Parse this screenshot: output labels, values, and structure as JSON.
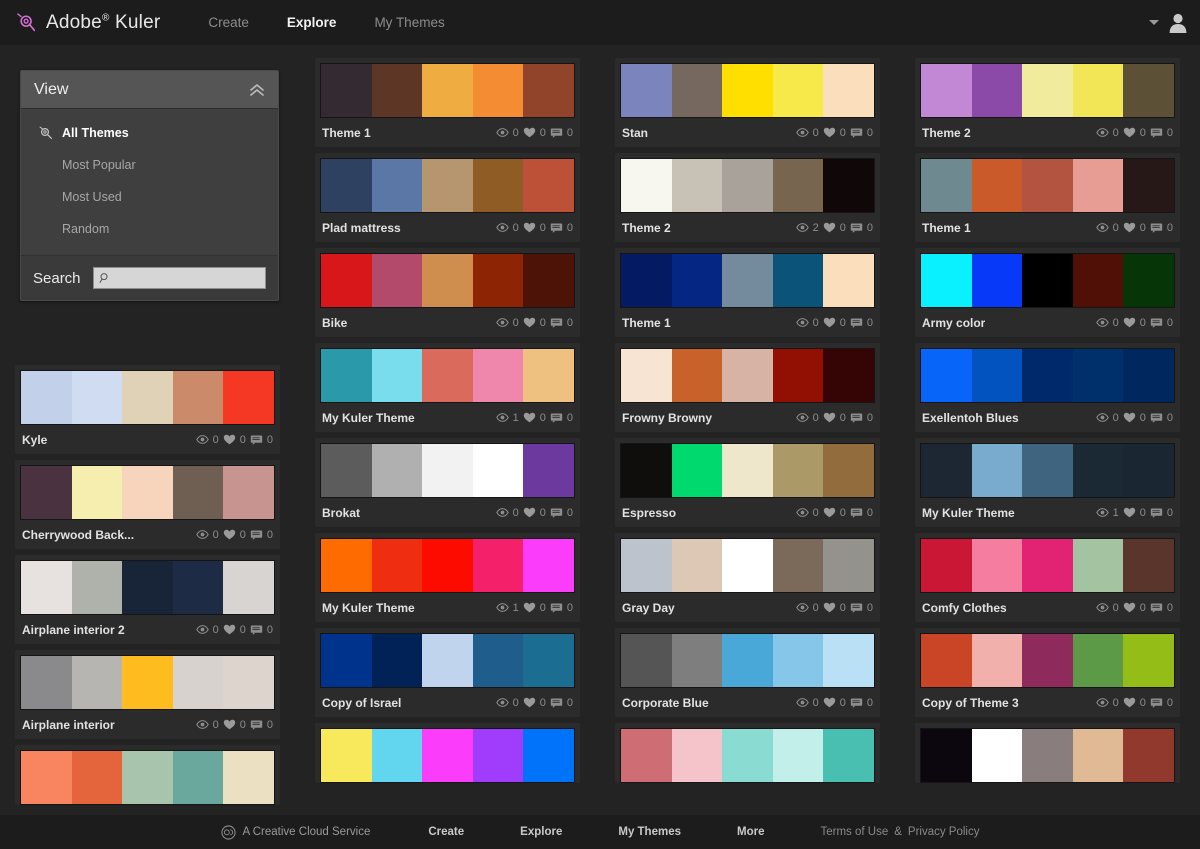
{
  "header": {
    "brand": "Adobe",
    "brand_sup": "®",
    "brand2": "Kuler",
    "logo_icon": "kuler-logo-icon",
    "nav": [
      {
        "label": "Create",
        "active": false
      },
      {
        "label": "Explore",
        "active": true
      },
      {
        "label": "My Themes",
        "active": false
      }
    ],
    "caret_icon": "chevron-down-icon",
    "avatar_icon": "user-avatar-icon"
  },
  "sidebar": {
    "title": "View",
    "collapse_icon": "chevron-double-up-icon",
    "items": [
      {
        "label": "All Themes",
        "active": true,
        "icon": "kuler-mark-icon"
      },
      {
        "label": "Most Popular",
        "active": false,
        "icon": ""
      },
      {
        "label": "Most Used",
        "active": false,
        "icon": ""
      },
      {
        "label": "Random",
        "active": false,
        "icon": ""
      }
    ],
    "search_label": "Search",
    "search_value": "",
    "search_placeholder": "",
    "search_icon": "magnifier-icon"
  },
  "stats_icons": {
    "views": "eye-icon",
    "likes": "heart-icon",
    "comments": "comment-icon"
  },
  "columns": [
    {
      "themes": [
        {
          "name": "Kyle",
          "views": "0",
          "likes": "0",
          "comments": "0",
          "colors": [
            "#c3d0ea",
            "#cfdcf2",
            "#e0d2b7",
            "#cb8a6a",
            "#f53823"
          ]
        },
        {
          "name": "Cherrywood Back...",
          "views": "0",
          "likes": "0",
          "comments": "0",
          "colors": [
            "#4b3240",
            "#f5eeae",
            "#f7d5bc",
            "#6f5e52",
            "#c79490"
          ]
        },
        {
          "name": "Airplane interior 2",
          "views": "0",
          "likes": "0",
          "comments": "0",
          "colors": [
            "#e7e1df",
            "#aeb2ab",
            "#182437",
            "#1e2b45",
            "#d7d4d1"
          ]
        },
        {
          "name": "Airplane interior",
          "views": "0",
          "likes": "0",
          "comments": "0",
          "colors": [
            "#8a8a8c",
            "#b7b5b1",
            "#ffbc1f",
            "#d8d2ce",
            "#ddd5cd"
          ]
        },
        {
          "name": "",
          "views": "",
          "likes": "",
          "comments": "",
          "partial": true,
          "colors": [
            "#f98560",
            "#e4653c",
            "#a9c4ad",
            "#6aa79c",
            "#ece0c2"
          ]
        }
      ]
    },
    {
      "themes": [
        {
          "name": "Theme 1",
          "views": "0",
          "likes": "0",
          "comments": "0",
          "colors": [
            "#332b31",
            "#5d3626",
            "#eeac41",
            "#f38c32",
            "#92442a"
          ]
        },
        {
          "name": "Plad mattress",
          "views": "0",
          "likes": "0",
          "comments": "0",
          "colors": [
            "#2f4161",
            "#5a77a6",
            "#b6966e",
            "#8e5c24",
            "#bd5138"
          ]
        },
        {
          "name": "Bike",
          "views": "0",
          "likes": "0",
          "comments": "0",
          "colors": [
            "#d8171b",
            "#b34a6b",
            "#cf8e4e",
            "#8d2505",
            "#4e1307"
          ]
        },
        {
          "name": "My Kuler Theme",
          "views": "1",
          "likes": "0",
          "comments": "0",
          "colors": [
            "#2a9aaa",
            "#79dded",
            "#d96a5c",
            "#ef87ad",
            "#eec181"
          ]
        },
        {
          "name": "Brokat",
          "views": "0",
          "likes": "0",
          "comments": "0",
          "colors": [
            "#5c5c5c",
            "#b0b0b0",
            "#f2f2f2",
            "#ffffff",
            "#6c399e"
          ]
        },
        {
          "name": "My Kuler Theme",
          "views": "1",
          "likes": "0",
          "comments": "0",
          "colors": [
            "#fe6b00",
            "#ef2d10",
            "#fe0b00",
            "#f42069",
            "#fb3cfb"
          ]
        },
        {
          "name": "Copy of Israel",
          "views": "0",
          "likes": "0",
          "comments": "0",
          "colors": [
            "#00338b",
            "#002257",
            "#c0d4ee",
            "#1f5d8c",
            "#1b6d92"
          ]
        },
        {
          "name": "",
          "views": "",
          "likes": "",
          "comments": "",
          "partial": true,
          "colors": [
            "#f8e85c",
            "#62d5ef",
            "#fb3cfb",
            "#a03cfb",
            "#0073fb"
          ]
        }
      ]
    },
    {
      "themes": [
        {
          "name": "Stan",
          "views": "0",
          "likes": "0",
          "comments": "0",
          "colors": [
            "#7c84bd",
            "#77685f",
            "#fedf00",
            "#f8e94a",
            "#fbdebb"
          ]
        },
        {
          "name": "Theme 2",
          "views": "2",
          "likes": "0",
          "comments": "0",
          "colors": [
            "#f7f6ef",
            "#c8c1b6",
            "#a9a29b",
            "#77654f",
            "#100808"
          ]
        },
        {
          "name": "Theme 1",
          "views": "0",
          "likes": "0",
          "comments": "0",
          "colors": [
            "#041a63",
            "#062683",
            "#738b9d",
            "#0c5379",
            "#fbdebb"
          ]
        },
        {
          "name": "Frowny Browny",
          "views": "0",
          "likes": "0",
          "comments": "0",
          "colors": [
            "#f8e4d3",
            "#c7622a",
            "#d6b3a5",
            "#911003",
            "#350404"
          ]
        },
        {
          "name": "Espresso",
          "views": "0",
          "likes": "0",
          "comments": "0",
          "colors": [
            "#100d0d",
            "#00d96e",
            "#eee7cb",
            "#ab9a68",
            "#926c3c"
          ]
        },
        {
          "name": "Gray Day",
          "views": "0",
          "likes": "0",
          "comments": "0",
          "colors": [
            "#bdc3cd",
            "#ddc8b5",
            "#ffffff",
            "#7b6959",
            "#93928d"
          ]
        },
        {
          "name": "Corporate Blue",
          "views": "0",
          "likes": "0",
          "comments": "0",
          "colors": [
            "#555555",
            "#7e7e7e",
            "#4aa8d8",
            "#86c6e8",
            "#bae0f5"
          ]
        },
        {
          "name": "",
          "views": "",
          "likes": "",
          "comments": "",
          "partial": true,
          "colors": [
            "#cf6d74",
            "#f4c4ca",
            "#8adcd3",
            "#c3efeb",
            "#49bfb2"
          ]
        }
      ]
    },
    {
      "themes": [
        {
          "name": "Theme 2",
          "views": "0",
          "likes": "0",
          "comments": "0",
          "colors": [
            "#c287d5",
            "#8c4aa8",
            "#f0eb9d",
            "#f3e656",
            "#5c5137"
          ]
        },
        {
          "name": "Theme 1",
          "views": "0",
          "likes": "0",
          "comments": "0",
          "colors": [
            "#6e8a90",
            "#cb5a2a",
            "#b2543f",
            "#e89d94",
            "#261816"
          ]
        },
        {
          "name": "Army color",
          "views": "0",
          "likes": "0",
          "comments": "0",
          "colors": [
            "#09f0ff",
            "#0639f8",
            "#000000",
            "#511005",
            "#063508"
          ]
        },
        {
          "name": "Exellentoh Blues",
          "views": "0",
          "likes": "0",
          "comments": "0",
          "colors": [
            "#0766f9",
            "#0252bf",
            "#00296b",
            "#00306c",
            "#00275e"
          ]
        },
        {
          "name": "My Kuler Theme",
          "views": "1",
          "likes": "0",
          "comments": "0",
          "colors": [
            "#1c2733",
            "#78abcd",
            "#3e6480",
            "#1b2935",
            "#1a2733"
          ]
        },
        {
          "name": "Comfy Clothes",
          "views": "0",
          "likes": "0",
          "comments": "0",
          "colors": [
            "#ca1735",
            "#f57ea0",
            "#e22374",
            "#a4c4a1",
            "#59352b"
          ]
        },
        {
          "name": "Copy of Theme 3",
          "views": "0",
          "likes": "0",
          "comments": "0",
          "colors": [
            "#ca4526",
            "#f2b0ad",
            "#8f2a5d",
            "#5d9a47",
            "#95bd17"
          ]
        },
        {
          "name": "",
          "views": "",
          "likes": "",
          "comments": "",
          "partial": true,
          "colors": [
            "#0c060f",
            "#ffffff",
            "#8a7d7d",
            "#e0b995",
            "#91392c"
          ]
        }
      ]
    }
  ],
  "footer": {
    "cc_icon": "creative-cloud-icon",
    "service_label": "A Creative Cloud Service",
    "links": [
      "Create",
      "Explore",
      "My Themes",
      "More"
    ],
    "terms_label": "Terms of Use",
    "amp": "&",
    "privacy_label": "Privacy Policy"
  }
}
